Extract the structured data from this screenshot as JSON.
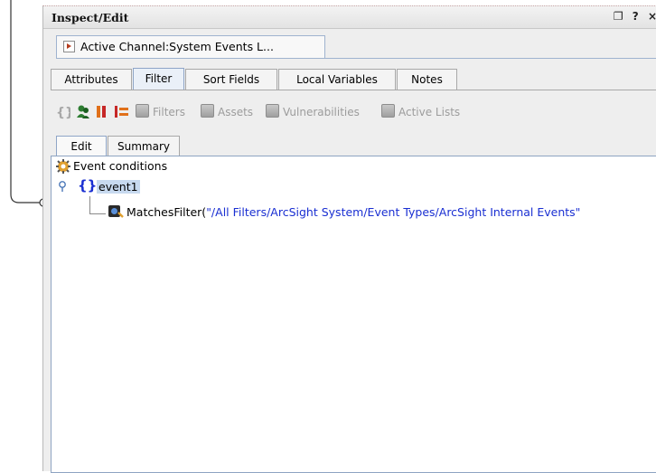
{
  "panel": {
    "title": "Inspect/Edit",
    "window_controls": [
      "❐",
      "?",
      "×"
    ]
  },
  "doc_tab": {
    "label": "Active Channel:System Events L..."
  },
  "tabs": [
    {
      "label": "Attributes"
    },
    {
      "label": "Filter"
    },
    {
      "label": "Sort Fields"
    },
    {
      "label": "Local Variables"
    },
    {
      "label": "Notes"
    }
  ],
  "toolbar": {
    "filters": "Filters",
    "assets": "Assets",
    "vulnerabilities": "Vulnerabilities",
    "active_lists": "Active Lists"
  },
  "inner_tabs": [
    {
      "label": "Edit"
    },
    {
      "label": "Summary"
    }
  ],
  "tree": {
    "root": "Event conditions",
    "group_symbol": "{}",
    "group": "event1",
    "condition_prefix": "MatchesFilter(",
    "condition_value": "\"/All Filters/ArcSight System/Event Types/ArcSight Internal Events\""
  },
  "colors": {
    "accent_blue": "#1a2fd2",
    "selection": "#c7d9ef",
    "panel_bg": "#eeeeee",
    "icon_orange": "#e0701a",
    "icon_green": "#2e7d32",
    "icon_red": "#c62828"
  }
}
